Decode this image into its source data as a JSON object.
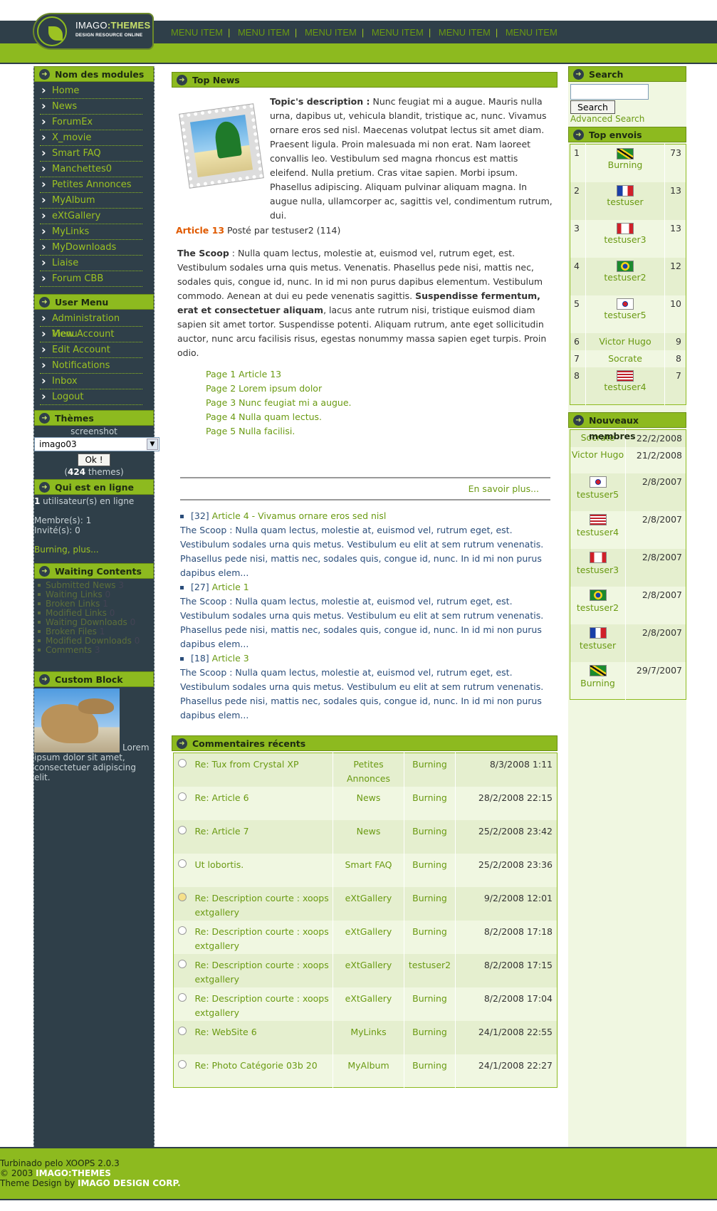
{
  "brand": {
    "title_a": "IMAGO",
    "title_b": ":THEMES",
    "subtitle": "DESIGN RESOURCE ONLINE"
  },
  "topnav": [
    "MENU ITEM",
    "MENU ITEM",
    "MENU ITEM",
    "MENU ITEM",
    "MENU ITEM",
    "MENU ITEM"
  ],
  "left": {
    "modules_title": "Nom des modules",
    "modules": [
      "Home",
      "News",
      "ForumEx",
      "X_movie",
      "Smart FAQ",
      "Manchettes0",
      "Petites Annonces",
      "MyAlbum",
      "eXtGallery",
      "MyLinks",
      "MyDownloads",
      "Liaise",
      "Forum CBB"
    ],
    "user_title": "User Menu",
    "user": [
      "Administration Menu",
      "View Account",
      "Edit Account",
      "Notifications",
      "Inbox",
      "Logout"
    ],
    "themes_title": "Thèmes",
    "themes_screenshot": "screenshot",
    "themes_select": "imago03",
    "themes_ok": "Ok !",
    "themes_count_a": "(",
    "themes_count": "424",
    "themes_count_b": " themes)",
    "online_title": "Qui est en ligne",
    "online_count": "1",
    "online_text": " utilisateur(s) en ligne",
    "online_members": "Membre(s): 1",
    "online_guests": "Invité(s): 0",
    "online_more": "Burning, plus...",
    "waiting_title": "Waiting Contents",
    "waiting": [
      {
        "label": "Submitted News",
        "count": "3"
      },
      {
        "label": "Waiting Links",
        "count": "0"
      },
      {
        "label": "Broken Links",
        "count": "1"
      },
      {
        "label": "Modified Links",
        "count": "0"
      },
      {
        "label": "Waiting Downloads",
        "count": "0"
      },
      {
        "label": "Broken Files",
        "count": "1"
      },
      {
        "label": "Modified Downloads",
        "count": "0"
      },
      {
        "label": "Comments",
        "count": "3"
      }
    ],
    "custom_title": "Custom Block",
    "custom_text": "Lorem ipsum dolor sit amet, consectetuer adipiscing elit."
  },
  "center": {
    "topnews_title": "Top News",
    "topic_label": "Topic's description :",
    "topic_text": " Nunc feugiat mi a augue. Mauris nulla urna, dapibus ut, vehicula blandit, tristique ac, nunc. Vivamus ornare eros sed nisl. Maecenas volutpat lectus sit amet diam. Praesent ligula. Proin malesuada mi non erat. Nam laoreet convallis leo. Vestibulum sed magna rhoncus est mattis eleifend. Nulla pretium. Cras vitae sapien. Morbi ipsum. Phasellus adipiscing. Aliquam pulvinar aliquam magna. In augue nulla, ullamcorper ac, sagittis vel, condimentum rutrum, dui.",
    "article_link": "Article 13",
    "article_by": " Posté par testuser2 (114)",
    "scoop_label": "The Scoop",
    "scoop_text1": " : Nulla quam lectus, molestie at, euismod vel, rutrum eget, est. Vestibulum sodales urna quis metus. Venenatis. Phasellus pede nisi, mattis nec, sodales quis, congue id, nunc. In id mi non purus dapibus elementum. Vestibulum commodo. Aenean at dui eu pede venenatis sagittis. ",
    "scoop_bold": "Suspendisse fermentum, erat et consectetuer aliquam",
    "scoop_text2": ", lacus ante rutrum nisi, tristique euismod diam sapien sit amet tortor. Suspendisse potenti. Aliquam rutrum, ante eget sollicitudin auctor, nunc arcu facilisis risus, egestas nonummy massa sapien eget turpis. Proin odio.",
    "pages": [
      "Page 1 Article 13",
      "Page 2 Lorem ipsum dolor",
      "Page 3 Nunc feugiat mi a augue.",
      "Page 4 Nulla quam lectus.",
      "Page 5 Nulla facilisi."
    ],
    "more": "En savoir plus...",
    "news": [
      {
        "num": "[32]",
        "title": "Article 4 - Vivamus ornare eros sed nisl",
        "body": "The Scoop : Nulla quam lectus, molestie at, euismod vel, rutrum eget, est. Vestibulum sodales urna quis metus. Vestibulum eu elit at sem rutrum venenatis. Phasellus pede nisi, mattis nec, sodales quis, congue id, nunc. In id mi non purus dapibus elem..."
      },
      {
        "num": "[27]",
        "title": "Article 1",
        "body": "The Scoop : Nulla quam lectus, molestie at, euismod vel, rutrum eget, est. Vestibulum sodales urna quis metus. Vestibulum eu elit at sem rutrum venenatis. Phasellus pede nisi, mattis nec, sodales quis, congue id, nunc. In id mi non purus dapibus elem..."
      },
      {
        "num": "[18]",
        "title": "Article 3",
        "body": "The Scoop : Nulla quam lectus, molestie at, euismod vel, rutrum eget, est. Vestibulum sodales urna quis metus. Vestibulum eu elit at sem rutrum venenatis. Phasellus pede nisi, mattis nec, sodales quis, congue id, nunc. In id mi non purus dapibus elem..."
      }
    ],
    "comments_title": "Commentaires récents",
    "comments": [
      {
        "title": "Re: Tux from Crystal XP",
        "module": "Petites Annonces",
        "user": "Burning",
        "date": "8/3/2008 1:11",
        "icon": "circle"
      },
      {
        "title": "Re: Article 6",
        "module": "News",
        "user": "Burning",
        "date": "28/2/2008 22:15",
        "icon": "circle"
      },
      {
        "title": "Re: Article 7",
        "module": "News",
        "user": "Burning",
        "date": "25/2/2008 23:42",
        "icon": "circle"
      },
      {
        "title": "Ut lobortis.",
        "module": "Smart FAQ",
        "user": "Burning",
        "date": "25/2/2008 23:36",
        "icon": "circle"
      },
      {
        "title": "Re: Description courte : xoops extgallery",
        "module": "eXtGallery",
        "user": "Burning",
        "date": "9/2/2008 12:01",
        "icon": "smile"
      },
      {
        "title": "Re: Description courte : xoops extgallery",
        "module": "eXtGallery",
        "user": "Burning",
        "date": "8/2/2008 17:18",
        "icon": "circle"
      },
      {
        "title": "Re: Description courte : xoops extgallery",
        "module": "eXtGallery",
        "user": "testuser2",
        "date": "8/2/2008 17:15",
        "icon": "circle"
      },
      {
        "title": "Re: Description courte : xoops extgallery",
        "module": "eXtGallery",
        "user": "Burning",
        "date": "8/2/2008 17:04",
        "icon": "circle"
      },
      {
        "title": "Re: WebSite 6",
        "module": "MyLinks",
        "user": "Burning",
        "date": "24/1/2008 22:55",
        "icon": "circle"
      },
      {
        "title": "Re: Photo Catégorie 03b 20",
        "module": "MyAlbum",
        "user": "Burning",
        "date": "24/1/2008 22:27",
        "icon": "circle"
      }
    ]
  },
  "right": {
    "search_title": "Search",
    "search_value": "",
    "search_button": "Search",
    "advanced": "Advanced Search",
    "top_title": "Top envois",
    "top": [
      {
        "rank": "1",
        "name": "Burning",
        "count": "73",
        "flag": "jamaica"
      },
      {
        "rank": "2",
        "name": "testuser",
        "count": "13",
        "flag": "france"
      },
      {
        "rank": "3",
        "name": "testuser3",
        "count": "13",
        "flag": "canada"
      },
      {
        "rank": "4",
        "name": "testuser2",
        "count": "12",
        "flag": "brazil"
      },
      {
        "rank": "5",
        "name": "testuser5",
        "count": "10",
        "flag": "korea"
      },
      {
        "rank": "6",
        "name": "Victor Hugo",
        "count": "9",
        "flag": ""
      },
      {
        "rank": "7",
        "name": "Socrate",
        "count": "8",
        "flag": ""
      },
      {
        "rank": "8",
        "name": "testuser4",
        "count": "7",
        "flag": "usa"
      }
    ],
    "new_title": "Nouveaux membres",
    "new": [
      {
        "name": "Socrate",
        "date": "22/2/2008",
        "flag": ""
      },
      {
        "name": "Victor Hugo",
        "date": "21/2/2008",
        "flag": ""
      },
      {
        "name": "testuser5",
        "date": "2/8/2007",
        "flag": "korea"
      },
      {
        "name": "testuser4",
        "date": "2/8/2007",
        "flag": "usa"
      },
      {
        "name": "testuser3",
        "date": "2/8/2007",
        "flag": "canada"
      },
      {
        "name": "testuser2",
        "date": "2/8/2007",
        "flag": "brazil"
      },
      {
        "name": "testuser",
        "date": "2/8/2007",
        "flag": "france"
      },
      {
        "name": "Burning",
        "date": "29/7/2007",
        "flag": "jamaica"
      }
    ]
  },
  "footer": {
    "line1": "Turbinado pelo XOOPS 2.0.3",
    "line2a": "© 2003 ",
    "line2b": "IMAGO:THEMES",
    "line3a": "Theme Design by ",
    "line3b": "IMAGO DESIGN CORP."
  },
  "colors": {
    "dark": "#2f3f49",
    "green": "#8dba1f",
    "link": "#6a9a12",
    "article": "#e05a00",
    "blue": "#2a4d7a"
  }
}
